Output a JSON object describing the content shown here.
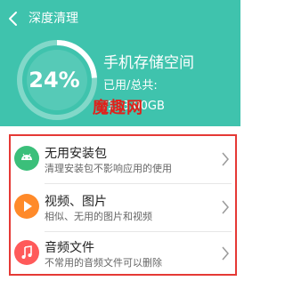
{
  "colors": {
    "header_bg": "#3fc3ad",
    "gauge_fill": "#ffffff",
    "highlight_border": "#e53935"
  },
  "header": {
    "title": "深度清理",
    "back_icon": "chevron-left-icon"
  },
  "storage": {
    "percent_label": "24%",
    "percent_value": 0.24,
    "title": "手机存储空间",
    "used_label": "已用/总共:",
    "used_value": "/128.00GB"
  },
  "watermark": {
    "text": "魔趣网"
  },
  "items": [
    {
      "title": "无用安装包",
      "subtitle": "清理安装包不影响应用的使用",
      "icon": "android-icon",
      "color": "#3bbf7a"
    },
    {
      "title": "视频、图片",
      "subtitle": "相似、无用的图片和视频",
      "icon": "play-icon",
      "color": "#ff8a2a"
    },
    {
      "title": "音频文件",
      "subtitle": "不常用的音频文件可以删除",
      "icon": "music-note-icon",
      "color": "#ff5a5a"
    }
  ]
}
